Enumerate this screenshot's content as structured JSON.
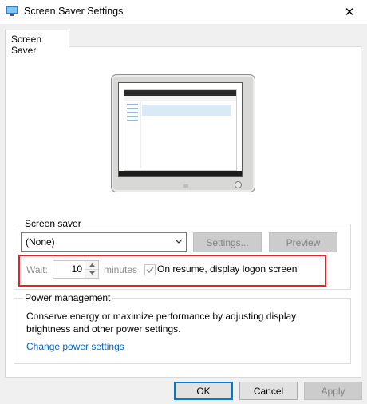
{
  "window": {
    "title": "Screen Saver Settings",
    "close_glyph": "✕"
  },
  "tabs": [
    {
      "label": "Screen Saver",
      "selected": true
    }
  ],
  "screen_saver": {
    "group_label": "Screen saver",
    "selected_value": "(None)",
    "settings_label": "Settings...",
    "preview_label": "Preview",
    "wait_label": "Wait:",
    "wait_value": "10",
    "minutes_label": "minutes",
    "resume_checkbox_label": "On resume, display logon screen",
    "resume_checked": true,
    "controls_disabled": true
  },
  "power": {
    "group_label": "Power management",
    "description": "Conserve energy or maximize performance by adjusting display brightness and other power settings.",
    "link_label": "Change power settings"
  },
  "footer": {
    "ok_label": "OK",
    "cancel_label": "Cancel",
    "apply_label": "Apply"
  },
  "colors": {
    "highlight_border": "#e8202a",
    "link": "#0066cc",
    "default_button_border": "#0078d7",
    "disabled_text": "#838383"
  }
}
